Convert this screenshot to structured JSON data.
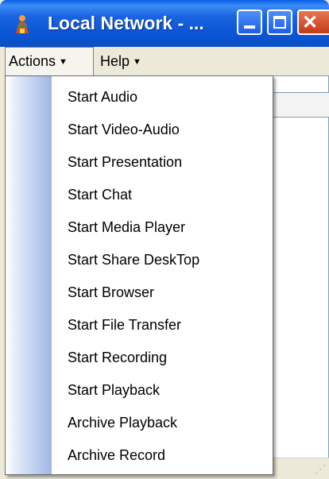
{
  "window": {
    "title": "Local Network - ...",
    "controls": {
      "minimize_icon": "minimize-icon",
      "maximize_icon": "maximize-icon",
      "close_icon": "close-icon",
      "close_glyph": "✕"
    }
  },
  "menubar": {
    "items": [
      {
        "label": "Actions",
        "arrow": "▼",
        "open": true
      },
      {
        "label": "Help",
        "arrow": "▼",
        "open": false
      }
    ]
  },
  "actions_menu": {
    "items": [
      {
        "label": "Start Audio"
      },
      {
        "label": "Start Video-Audio"
      },
      {
        "label": "Start Presentation"
      },
      {
        "label": "Start Chat"
      },
      {
        "label": "Start Media Player"
      },
      {
        "label": "Start Share DeskTop"
      },
      {
        "label": "Start Browser"
      },
      {
        "label": "Start File Transfer"
      },
      {
        "label": "Start Recording"
      },
      {
        "label": "Start Playback"
      },
      {
        "label": "Archive Playback"
      },
      {
        "label": "Archive Record"
      }
    ]
  },
  "colors": {
    "titlebar": "#0b56d6",
    "menu_background": "#ece9d8",
    "dropdown_background": "#ffffff",
    "gutter_accent": "#9fb6e4",
    "close_button": "#c4391b"
  }
}
